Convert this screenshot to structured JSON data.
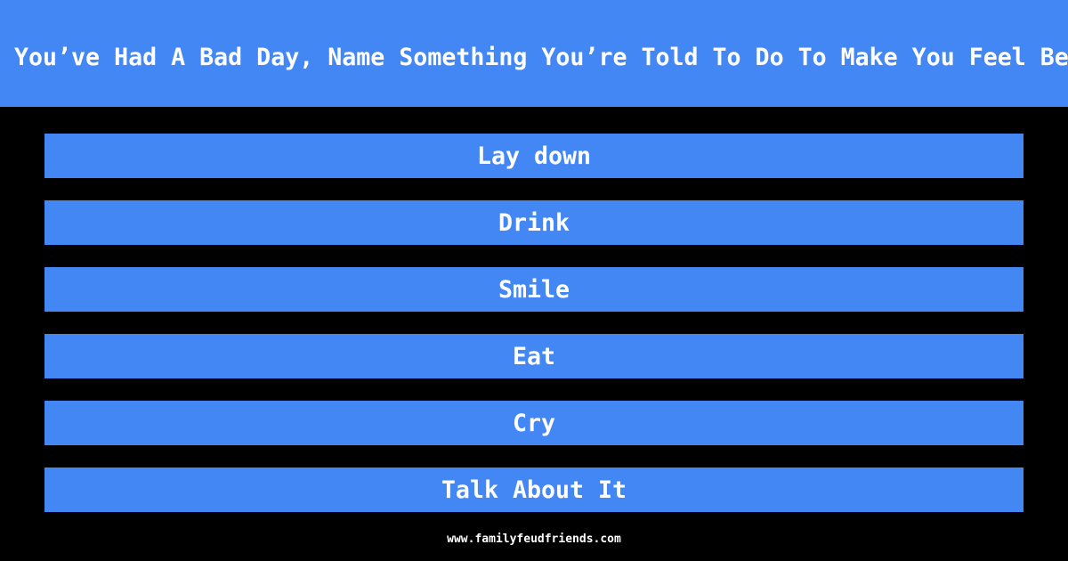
{
  "question": "You’ve Had A Bad Day, Name Something You’re Told To Do To Make You Feel Better",
  "answers": [
    "Lay down",
    "Drink",
    "Smile",
    "Eat",
    "Cry",
    "Talk About It"
  ],
  "footer": "www.familyfeudfriends.com",
  "colors": {
    "accent": "#4387f4",
    "background": "#000000",
    "text": "#ffffff"
  }
}
